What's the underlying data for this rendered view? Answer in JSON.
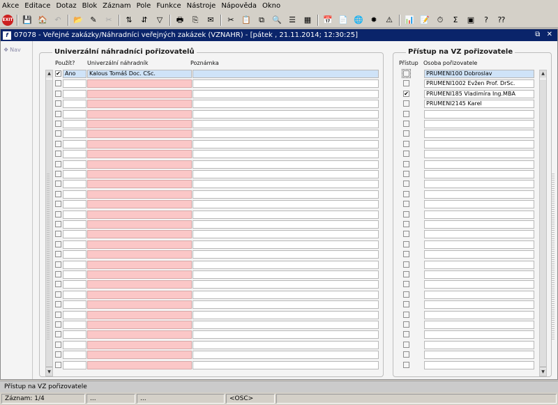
{
  "menu": [
    "Akce",
    "Editace",
    "Dotaz",
    "Blok",
    "Záznam",
    "Pole",
    "Funkce",
    "Nástroje",
    "Nápověda",
    "Okno"
  ],
  "toolbar": {
    "exit_label": "EXIT",
    "icons": [
      "save-icon",
      "folder-open-icon",
      "delete-icon",
      "print-icon",
      "filter-icon"
    ]
  },
  "window": {
    "title": "07078 - Veřejné zakázky/Náhradníci veřejných zakázek (VZNAHR) - [pátek , 21.11.2014; 12:30:25]",
    "logo": "f",
    "controls": "⧉ ✕"
  },
  "nav": {
    "label": "Nav"
  },
  "left_group": {
    "title": "Univerzální náhradníci pořizovatelů",
    "headers": {
      "use": "Použít?",
      "substitute": "Univerzální náhradník",
      "note": "Poznámka"
    },
    "rows": [
      {
        "checked": true,
        "use_text": "Ano",
        "substitute": "Kalous Tomáš Doc. CSc.",
        "note": ""
      }
    ],
    "total_rows": 30
  },
  "right_group": {
    "title": "Přístup na VZ pořizovatele",
    "headers": {
      "access": "Přístup",
      "person": "Osoba pořizovatele"
    },
    "rows": [
      {
        "checked": false,
        "person": "PRUMENI100 Dobroslav"
      },
      {
        "checked": false,
        "person": "PRUMENI1002 Evžen Prof. DrSc."
      },
      {
        "checked": true,
        "person": "PRUMENI185 Vladimíra Ing.MBA"
      },
      {
        "checked": false,
        "person": "PRUMENI2145 Karel"
      }
    ],
    "total_rows": 30
  },
  "status": {
    "message": "Přístup na VZ pořizovatele",
    "record": "Záznam: 1/4",
    "seg2": "...",
    "seg3": "...",
    "mode": "<OSC>"
  }
}
